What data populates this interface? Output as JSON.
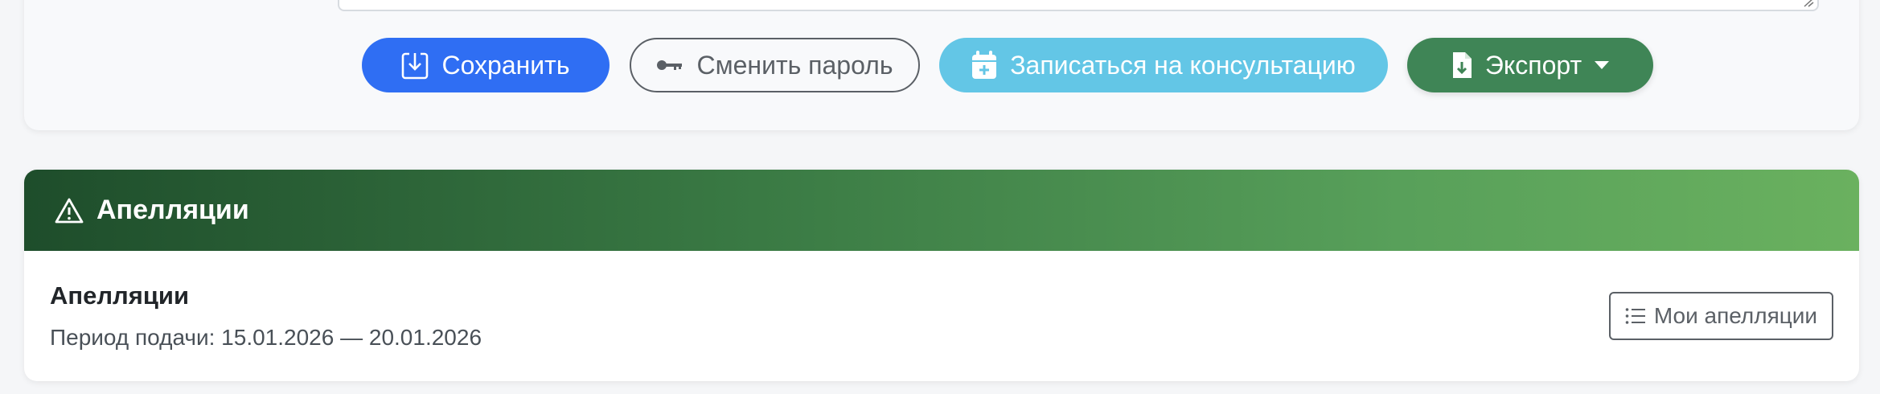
{
  "toolbar": {
    "save_label": "Сохранить",
    "change_password_label": "Сменить пароль",
    "consultation_label": "Записаться на консультацию",
    "export_label": "Экспорт"
  },
  "appeals": {
    "header_title": "Апелляции",
    "item_title": "Апелляции",
    "period_text": "Период подачи: 15.01.2026 — 20.01.2026",
    "my_appeals_label": "Мои апелляции"
  },
  "colors": {
    "primary": "#2f6ef3",
    "info": "#63c6e6",
    "success": "#3f8556",
    "secondary": "#5b6066",
    "header_gradient_start": "#1e4d2b",
    "header_gradient_end": "#6ab15f"
  },
  "icons": {
    "save": "download-box-icon",
    "password": "key-icon",
    "consultation": "calendar-plus-icon",
    "export": "file-download-icon",
    "appeals_header": "warning-triangle-icon",
    "my_appeals": "list-icon"
  }
}
